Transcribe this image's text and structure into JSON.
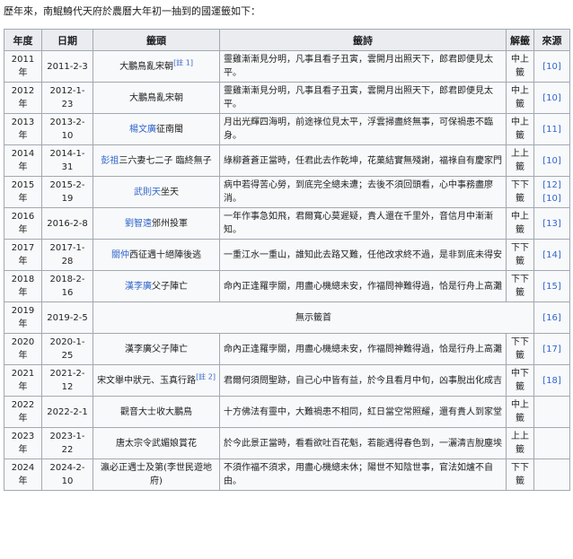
{
  "intro": "歷年來，南鯤鯓代天府於農曆大年初一抽到的國運籤如下：",
  "headers": {
    "year": "年度",
    "date": "日期",
    "title": "籤頭",
    "poem": "籤詩",
    "interp": "解籤",
    "source": "來源"
  },
  "rows": [
    {
      "year": "2011年",
      "date": "2011-2-3",
      "title_pre": "",
      "title_link": "",
      "title_post": "大鵬鳥亂宋朝",
      "note": "[註 1]",
      "poem": "靈雞漸漸見分明，凡事且看子丑寅，雲開月出照天下，郎君即便見太平。",
      "interp": "中上籤",
      "source": "[10]"
    },
    {
      "year": "2012年",
      "date": "2012-1-23",
      "title_pre": "",
      "title_link": "",
      "title_post": "大鵬鳥亂宋朝",
      "note": "",
      "poem": "靈雞漸漸見分明，凡事且看子丑寅，雲開月出照天下，郎君即便見太平。",
      "interp": "中上籤",
      "source": "[10]"
    },
    {
      "year": "2013年",
      "date": "2013-2-10",
      "title_pre": "",
      "title_link": "楊文廣",
      "title_post": "征南閩",
      "note": "",
      "poem": "月出光輝四海明，前途祿位見太平，浮雲掃盡終無事，可保禍患不臨身。",
      "interp": "中上籤",
      "source": "[11]"
    },
    {
      "year": "2014年",
      "date": "2014-1-31",
      "title_pre": "",
      "title_link": "彭祖",
      "title_post": "三六妻七二子 臨終無子",
      "note": "",
      "poem": "綠柳蒼蒼正當時，任君此去作乾坤，花菓結實無殘謝，福祿自有慶家門",
      "interp": "上上籤",
      "source": "[10]"
    },
    {
      "year": "2015年",
      "date": "2015-2-19",
      "title_pre": "",
      "title_link": "武則天",
      "title_post": "坐天",
      "note": "",
      "poem": "病中若得苦心勞，到底完全總未遭；去後不須回頭看，心中事務盡廖消。",
      "interp": "下下籤",
      "source": "[12][10]"
    },
    {
      "year": "2016年",
      "date": "2016-2-8",
      "title_pre": "",
      "title_link": "劉智遠",
      "title_post": "邠州投軍",
      "note": "",
      "poem": "一年作事急如飛，君爾寬心莫遲疑，貴人還在千里外，音信月中漸漸知。",
      "interp": "中上籤",
      "source": "[13]"
    },
    {
      "year": "2017年",
      "date": "2017-1-28",
      "title_pre": "",
      "title_link": "關仲",
      "title_post": "西征遇十絕陣後逃",
      "note": "",
      "poem": "一重江水一重山，誰知此去路又難，任他改求終不過，是非到底未得安",
      "interp": "下下籤",
      "source": "[14]"
    },
    {
      "year": "2018年",
      "date": "2018-2-16",
      "title_pre": "",
      "title_link": "漢李廣",
      "title_post": "父子陣亡",
      "note": "",
      "poem": "命內正逢羅孛關，用盡心機總未安，作福問神難得過，恰是行舟上高灘",
      "interp": "下下籤",
      "source": "[15]"
    },
    {
      "year": "2019年",
      "date": "2019-2-5",
      "title_pre": "",
      "title_link": "",
      "title_post": "",
      "note": "",
      "poem": "無示籤首",
      "interp": "",
      "source": "[16]"
    },
    {
      "year": "2020年",
      "date": "2020-1-25",
      "title_pre": "",
      "title_link": "",
      "title_post": "漢李廣父子陣亡",
      "note": "",
      "poem": "命內正逢羅孛關，用盡心機總未安，作福問神難得過，恰是行舟上高灘",
      "interp": "下下籤",
      "source": "[17]"
    },
    {
      "year": "2021年",
      "date": "2021-2-12",
      "title_pre": "",
      "title_link": "",
      "title_post": "宋文舉中狀元、玉真行路",
      "note": "[註 2]",
      "poem": "君爾何須問聖跡，自己心中皆有益，於今且看月中旬，凶事脫出化成吉",
      "interp": "中下籤",
      "source": "[18]"
    },
    {
      "year": "2022年",
      "date": "2022-2-1",
      "title_pre": "",
      "title_link": "",
      "title_post": "觀音大士收大鵬鳥",
      "note": "",
      "poem": "十方佛法有靈中，大難禍患不相同，紅日當空常照耀，還有貴人到家堂",
      "interp": "中上籤",
      "source": ""
    },
    {
      "year": "2023年",
      "date": "2023-1-22",
      "title_pre": "",
      "title_link": "",
      "title_post": "唐太宗令武媚娘賞花",
      "note": "",
      "poem": "於今此景正當時，看看欲吐百花魁，若能遇得春色到，一灑清吉脫塵埃",
      "interp": "上上籤",
      "source": ""
    },
    {
      "year": "2024年",
      "date": "2024-2-10",
      "title_pre": "",
      "title_link": "",
      "title_post": "瀛必正遇士及第(李世民遊地府)",
      "note": "",
      "poem": "不須作福不須求，用盡心機總未休；陽世不知陰世事，官法如爐不自由。",
      "interp": "下下籤",
      "source": ""
    }
  ]
}
